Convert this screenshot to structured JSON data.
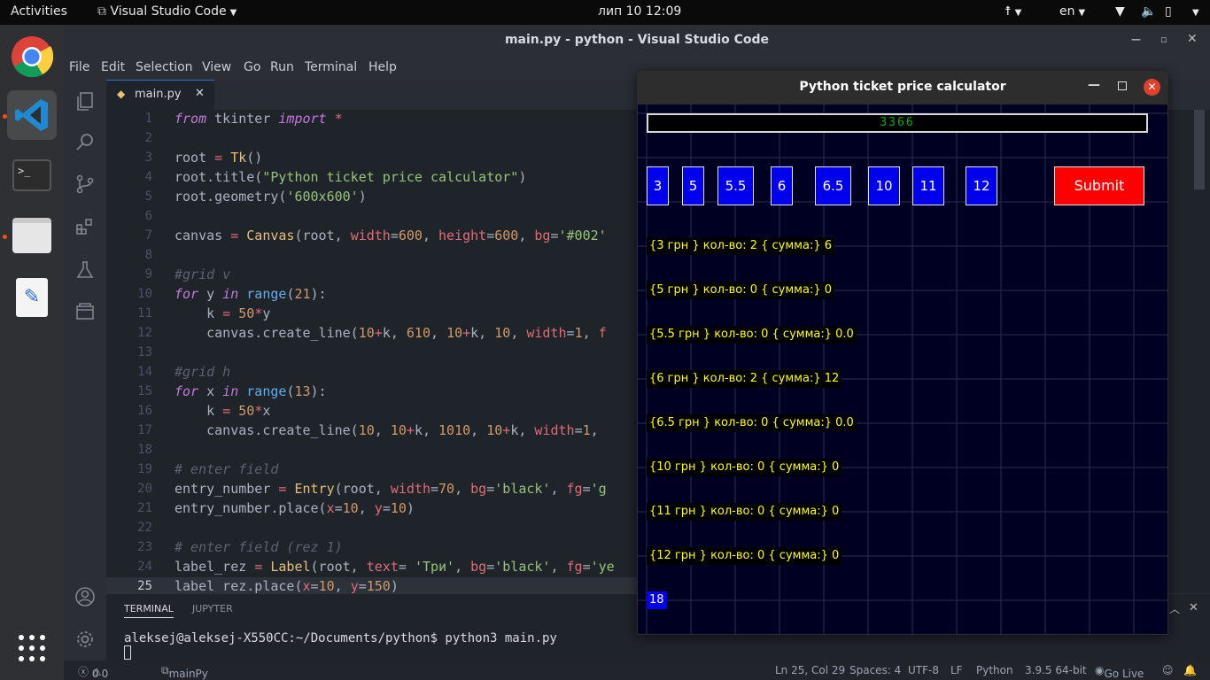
{
  "topbar": {
    "activities": "Activities",
    "app_menu": "Visual Studio Code",
    "clock": "лип 10  12:09",
    "lang": "en"
  },
  "vscode": {
    "window_title": "main.py - python - Visual Studio Code",
    "menu": [
      "File",
      "Edit",
      "Selection",
      "View",
      "Go",
      "Run",
      "Terminal",
      "Help"
    ],
    "tab_label": "main.py",
    "code_lines": [
      "1",
      "2",
      "3",
      "4",
      "5",
      "6",
      "7",
      "8",
      "9",
      "10",
      "11",
      "12",
      "13",
      "14",
      "15",
      "16",
      "17",
      "18",
      "19",
      "20",
      "21",
      "22",
      "23",
      "24",
      "25"
    ],
    "panel_tabs": [
      "TERMINAL",
      "JUPYTER"
    ],
    "terminal_line": "aleksej@aleksej-X550CC:~/Documents/python$ python3 main.py",
    "status": {
      "errors": "0",
      "warnings": "0",
      "branch": "mainPy",
      "position": "Ln 25, Col 29",
      "spaces": "Spaces: 4",
      "encoding": "UTF-8",
      "eol": "LF",
      "language": "Python",
      "interpreter": "3.9.5 64-bit",
      "golive": "Go Live"
    }
  },
  "tk_app": {
    "title": "Python ticket price calculator",
    "entry_value": "3366",
    "price_buttons": [
      "3",
      "5",
      "5.5",
      "6",
      "6.5",
      "10",
      "11",
      "12"
    ],
    "submit_label": "Submit",
    "result_lines": [
      "{3 грн } кол-во: 2 { сумма:} 6",
      "{5 грн } кол-во: 0 { сумма:} 0",
      "{5.5 грн } кол-во: 0 { сумма:} 0.0",
      "{6 грн } кол-во: 2 { сумма:} 12",
      "{6.5 грн } кол-во: 0 { сумма:} 0.0",
      "{10 грн } кол-во: 0 { сумма:} 0",
      "{11 грн } кол-во: 0 { сумма:} 0",
      "{12 грн } кол-во: 0 { сумма:} 0"
    ],
    "total": "18",
    "colors": {
      "canvas_bg": "#000022",
      "button_bg": "#0000ee",
      "submit_bg": "#ff0000",
      "label_fg": "#ffff00",
      "entry_fg": "#00b000"
    }
  }
}
